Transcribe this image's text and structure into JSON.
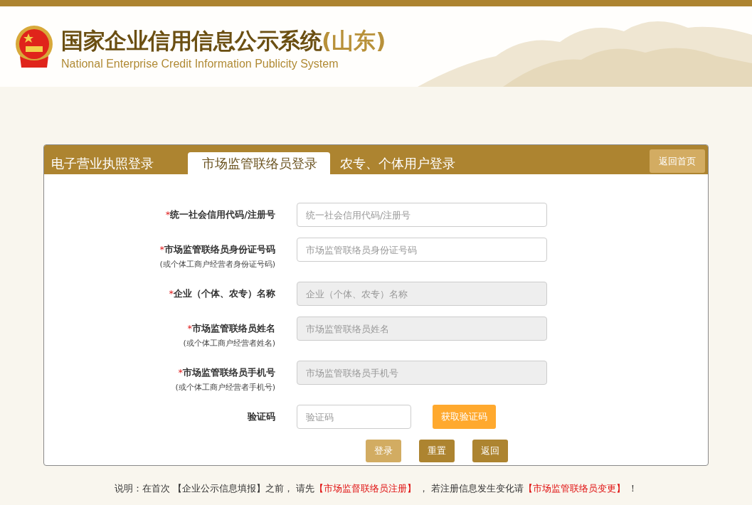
{
  "header": {
    "title": "国家企业信用信息公示系统",
    "region": "(山东)",
    "subtitle": "National Enterprise Credit Information Publicity System"
  },
  "tabs": [
    {
      "label": "电子营业执照登录",
      "selected": false
    },
    {
      "label": "市场监管联络员登录",
      "selected": true
    },
    {
      "label": "农专、个体用户登录",
      "selected": false
    }
  ],
  "home_button": "返回首页",
  "fields": [
    {
      "mark": "*",
      "label": "统一社会信用代码/注册号",
      "placeholder": "统一社会信用代码/注册号",
      "disabled": false
    },
    {
      "mark": "*",
      "label": "市场监管联络员身份证号码",
      "note": "(或个体工商户经营者身份证号码)",
      "placeholder": "市场监管联络员身份证号码",
      "disabled": false
    },
    {
      "mark": "*",
      "label": "企业（个体、农专）名称",
      "placeholder": "企业（个体、农专）名称",
      "disabled": true
    },
    {
      "mark": "*",
      "label": "市场监管联络员姓名",
      "note": "(或个体工商户经营者姓名)",
      "placeholder": "市场监管联络员姓名",
      "disabled": true
    },
    {
      "mark": "*",
      "label": "市场监管联络员手机号",
      "note": "(或个体工商户经营者手机号)",
      "placeholder": "市场监管联络员手机号",
      "disabled": true
    }
  ],
  "captcha": {
    "label": "验证码",
    "placeholder": "验证码",
    "button": "获取验证码"
  },
  "actions": [
    {
      "label": "登录",
      "kind": "primary"
    },
    {
      "label": "重置",
      "kind": "secondary"
    },
    {
      "label": "返回",
      "kind": "secondary"
    }
  ],
  "notice": [
    {
      "kind": "text",
      "text": "说明：在首次 【企业公示信息填报】之前， 请先"
    },
    {
      "kind": "link",
      "text": "【市场监督联络员注册】"
    },
    {
      "kind": "text",
      "text": " ， 若注册信息发生变化请"
    },
    {
      "kind": "link",
      "text": "【市场监管联络员变更】"
    },
    {
      "kind": "text",
      "text": " ！"
    }
  ]
}
